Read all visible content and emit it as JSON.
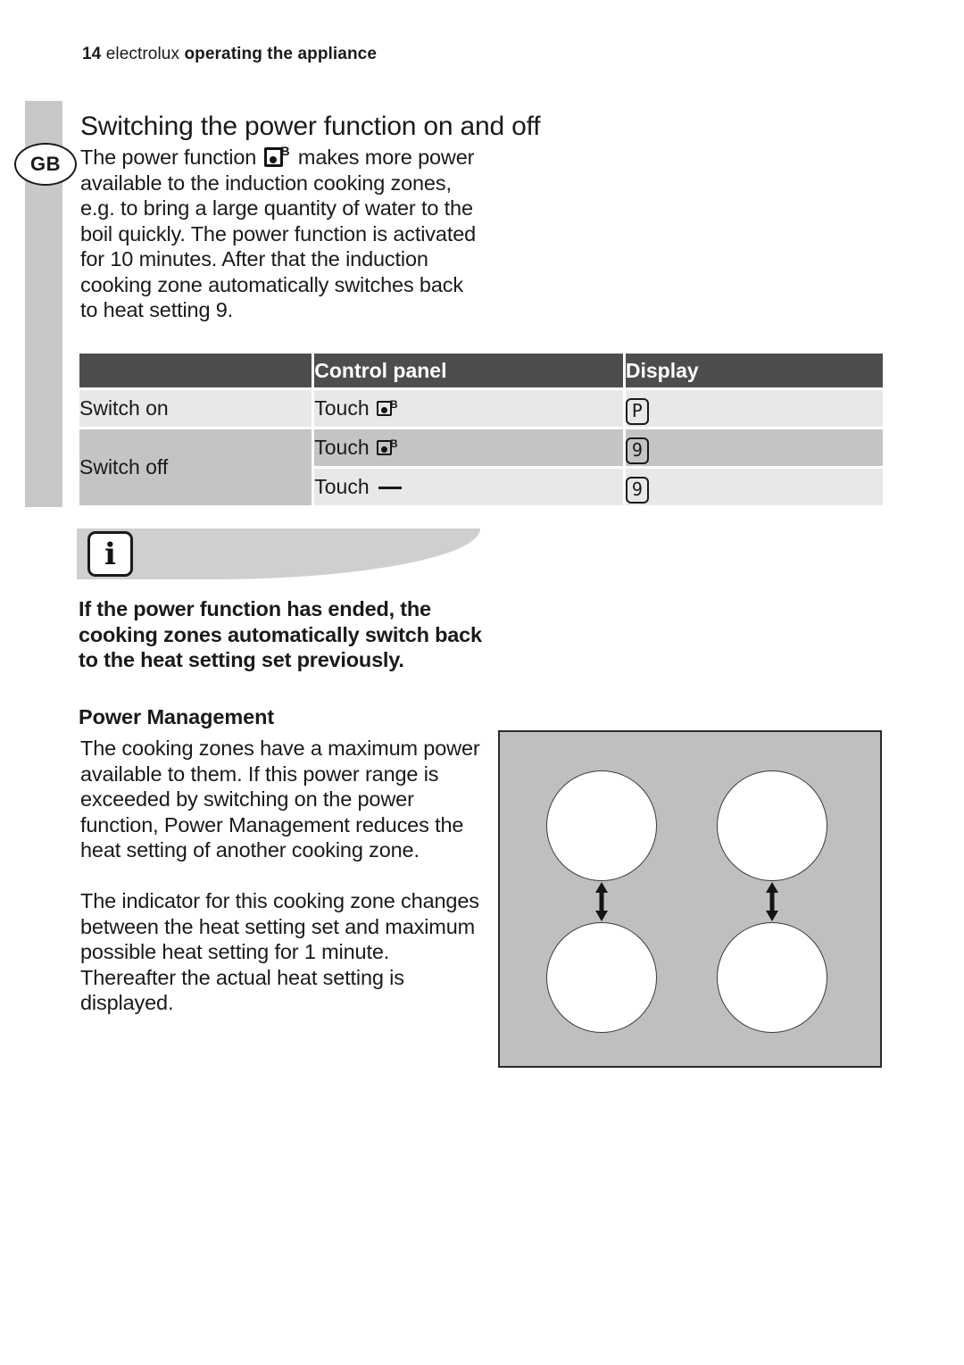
{
  "page_header": {
    "page_number": "14",
    "brand": "electrolux",
    "section": "operating the appliance"
  },
  "language_badge": "GB",
  "section_title": "Switching the power function on and off",
  "intro_paragraph": {
    "before_icon": "The power function ",
    "icon": "power-function-icon",
    "after_icon": " makes more power available to the induction cooking zones, e.g. to bring a large quantity of water to the boil quickly. The power function is activated for 10 minutes. After that the induction cooking zone automatically switches back to heat setting 9."
  },
  "table": {
    "headers": [
      "",
      "Control panel",
      "Display"
    ],
    "rows": [
      {
        "action": "Switch on",
        "control_prefix": "Touch",
        "control_icon": "power-function-icon",
        "display": "P"
      },
      {
        "action": "Switch off",
        "control_prefix": "Touch",
        "control_icon": "power-function-icon",
        "display": "9"
      },
      {
        "action": "",
        "control_prefix": "Touch",
        "control_icon": "minus-icon",
        "display": "9"
      }
    ]
  },
  "info_callout": {
    "icon": "info-icon",
    "icon_glyph": "i",
    "text": "If the power function has ended, the cooking zones automatically switch back to the heat setting set previously."
  },
  "subheading": "Power Management",
  "power_management_paragraph_1": "The cooking zones have a maximum power available to them. If this power range is exceeded by switching on the power function, Power Management reduces the heat setting of another cooking zone.",
  "power_management_paragraph_2": "The indicator for this cooking zone changes between the heat setting set and maximum possible heat setting for 1 minute. Thereafter the actual heat setting is displayed.",
  "hob_diagram": {
    "zones": [
      "top-left",
      "top-right",
      "bottom-left",
      "bottom-right"
    ],
    "arrows": [
      "left-pair-arrow",
      "right-pair-arrow"
    ]
  },
  "colors": {
    "table_header_bg": "#4d4d4d",
    "row_light_bg": "#e8e8e8",
    "row_dark_bg": "#c4c4c4",
    "spine_gray": "#c8c8c8",
    "banner_gray": "#cfcfcf",
    "hob_gray": "#bfbfbf"
  }
}
